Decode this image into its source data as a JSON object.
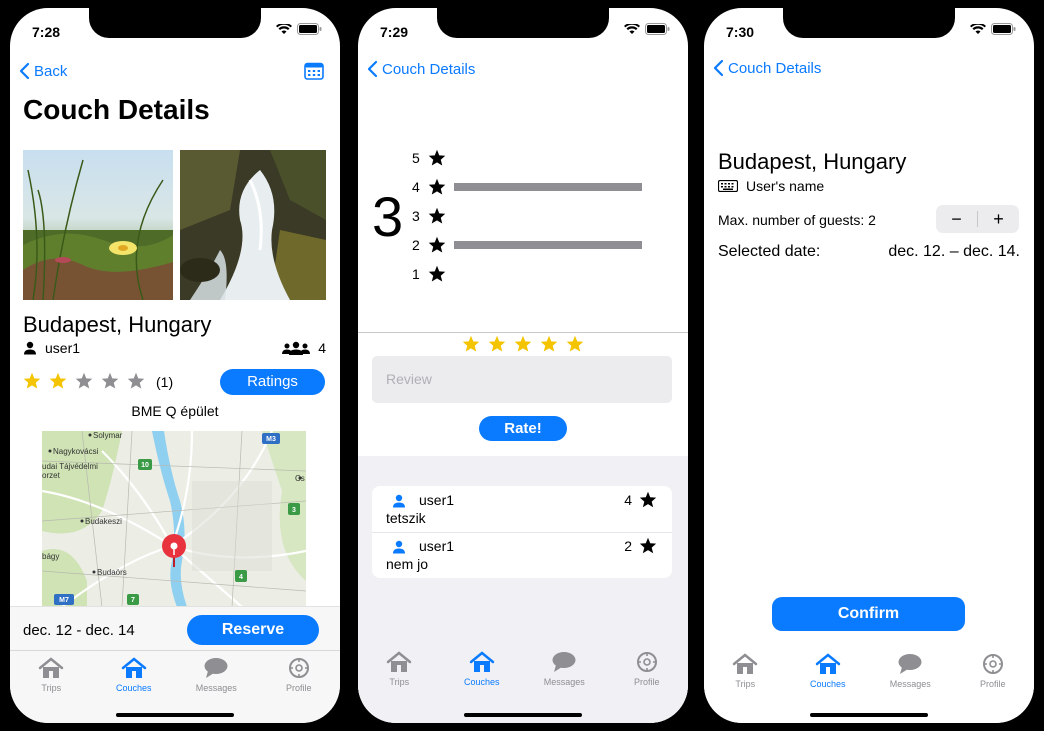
{
  "colors": {
    "accent": "#0a7aff",
    "star_filled": "#f5c400",
    "star_empty": "#8e8e93"
  },
  "phone1": {
    "time": "7:28",
    "back_label": "Back",
    "title": "Couch Details",
    "location": "Budapest, Hungary",
    "host": "user1",
    "capacity": "4",
    "rating_value": 2,
    "rating_count": "(1)",
    "ratings_button": "Ratings",
    "venue": "BME Q épület",
    "map_labels": [
      "Solymar",
      "Nagykovácsi",
      "udai Tájvédelmi",
      "orzet",
      "Budakeszi",
      "bágy",
      "Budaörs",
      "Cs"
    ],
    "map_shields": [
      "M3",
      "10",
      "3",
      "4",
      "7",
      "M7"
    ],
    "date_range": "dec. 12 - dec. 14",
    "reserve_button": "Reserve",
    "tabs": [
      "Trips",
      "Couches",
      "Messages",
      "Profile"
    ]
  },
  "phone2": {
    "time": "7:29",
    "back_label": "Couch Details",
    "average": "3",
    "histogram": [
      {
        "stars": "5",
        "count": 0
      },
      {
        "stars": "4",
        "count": 1
      },
      {
        "stars": "3",
        "count": 0
      },
      {
        "stars": "2",
        "count": 1
      },
      {
        "stars": "1",
        "count": 0
      }
    ],
    "input_rating": 5,
    "review_placeholder": "Review",
    "rate_button": "Rate!",
    "reviews": [
      {
        "user": "user1",
        "text": "tetszik",
        "stars": "4"
      },
      {
        "user": "user1",
        "text": "nem jo",
        "stars": "2"
      }
    ],
    "tabs": [
      "Trips",
      "Couches",
      "Messages",
      "Profile"
    ]
  },
  "phone3": {
    "time": "7:30",
    "back_label": "Couch Details",
    "location": "Budapest, Hungary",
    "user_name": "User's name",
    "guests_label": "Max. number of guests: 2",
    "stepper_minus": "−",
    "stepper_plus": "+",
    "date_label": "Selected date:",
    "date_value": "dec. 12. – dec. 14.",
    "confirm_button": "Confirm",
    "tabs": [
      "Trips",
      "Couches",
      "Messages",
      "Profile"
    ]
  }
}
